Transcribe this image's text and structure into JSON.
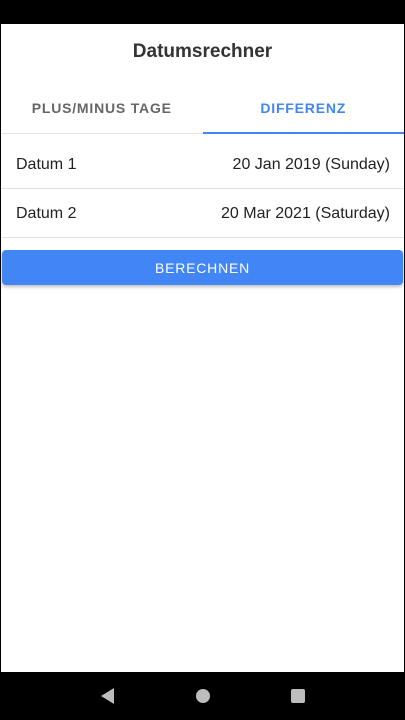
{
  "app": {
    "title": "Datumsrechner"
  },
  "tabs": [
    {
      "label": "PLUS/MINUS TAGE",
      "active": false
    },
    {
      "label": "DIFFERENZ",
      "active": true
    }
  ],
  "dates": [
    {
      "label": "Datum 1",
      "value": "20 Jan 2019 (Sunday)"
    },
    {
      "label": "Datum 2",
      "value": "20 Mar 2021 (Saturday)"
    }
  ],
  "actions": {
    "calculate_label": "BERECHNEN"
  },
  "colors": {
    "accent": "#4285f4",
    "title_text": "#333333",
    "tab_inactive": "#666666"
  },
  "nav_bar": {
    "icons": [
      "back-icon",
      "home-icon",
      "recents-icon"
    ]
  }
}
